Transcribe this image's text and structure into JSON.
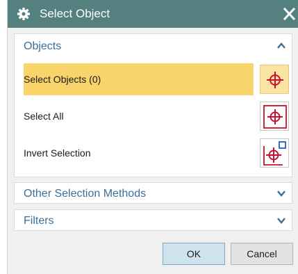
{
  "dialog": {
    "title": "Select Object",
    "title_icon": "gear-icon",
    "close_icon": "close-icon"
  },
  "objects_section": {
    "title": "Objects",
    "expanded": true,
    "chevron_icon": "chevron-up-icon",
    "rows": [
      {
        "label": "Select Objects (0)",
        "icon": "crosshair-icon",
        "active": true
      },
      {
        "label": "Select All",
        "icon": "select-all-crosshair-icon",
        "active": false
      },
      {
        "label": "Invert Selection",
        "icon": "invert-selection-crosshair-icon",
        "active": false
      }
    ]
  },
  "other_section": {
    "title": "Other Selection Methods",
    "expanded": false,
    "chevron_icon": "chevron-down-icon"
  },
  "filters_section": {
    "title": "Filters",
    "expanded": false,
    "chevron_icon": "chevron-down-icon"
  },
  "footer": {
    "ok_label": "OK",
    "cancel_label": "Cancel"
  },
  "colors": {
    "titlebar": "#54807f",
    "section_title": "#3a6f9a",
    "active_row": "#f9d46b",
    "crosshair": "#c8102e"
  }
}
